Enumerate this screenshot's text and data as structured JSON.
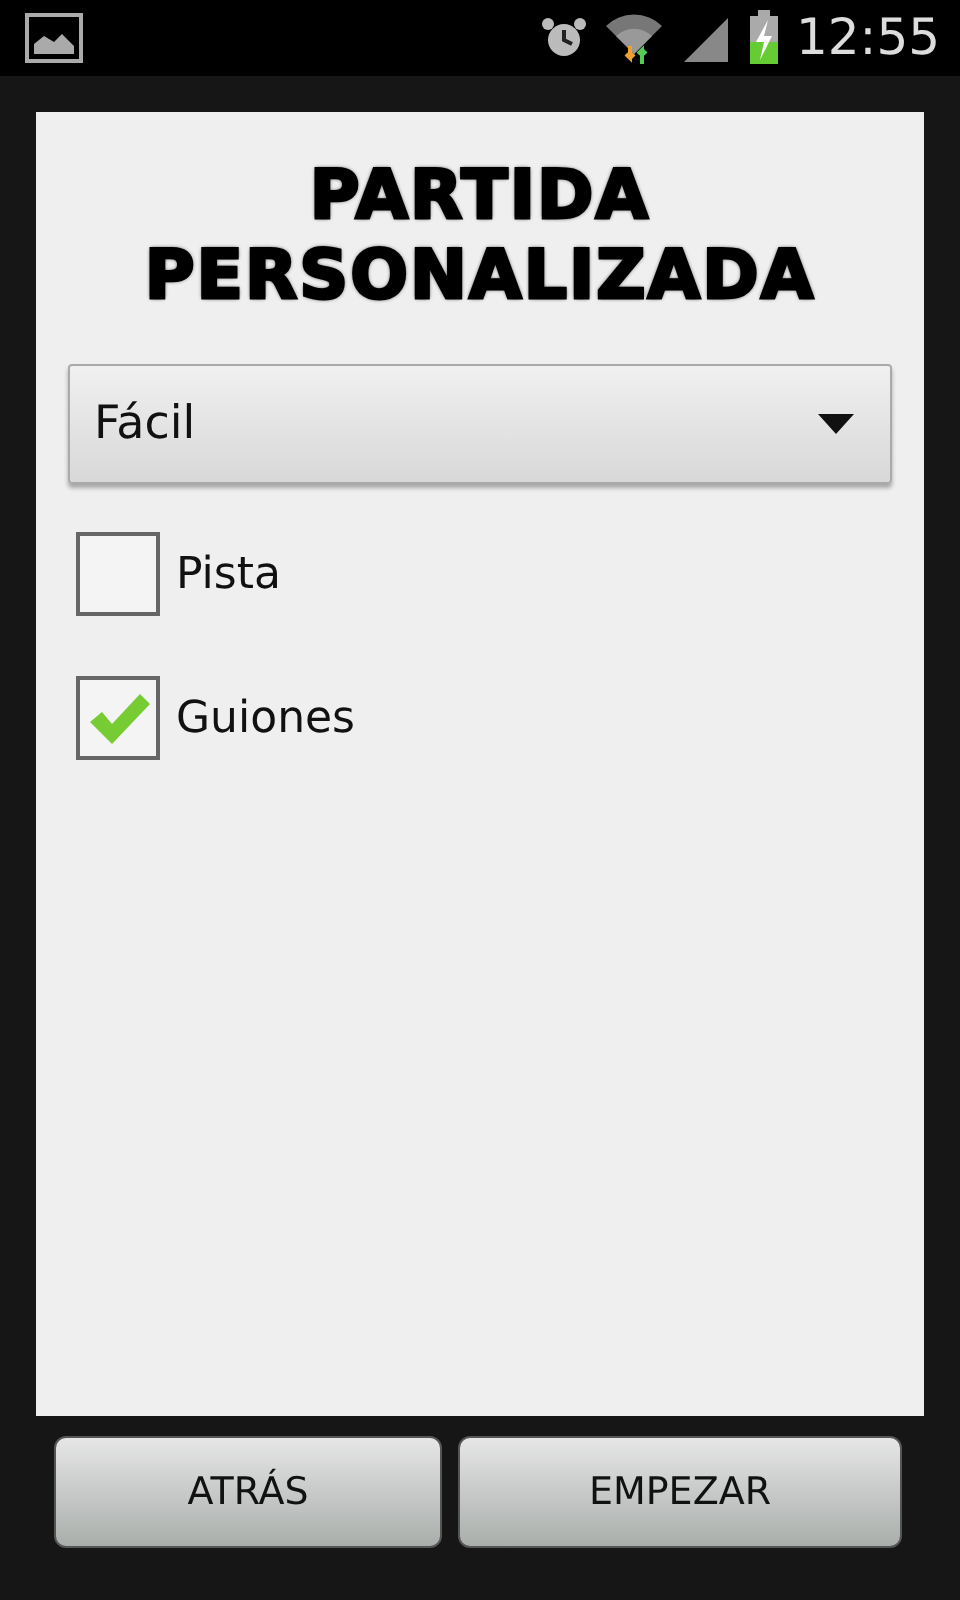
{
  "status_bar": {
    "time": "12:55"
  },
  "title": [
    "PARTIDA",
    "PERSONALIZADA"
  ],
  "difficulty": {
    "value": "Fácil"
  },
  "options": [
    {
      "label": "Pista",
      "checked": false
    },
    {
      "label": "Guiones",
      "checked": true
    }
  ],
  "buttons": [
    "ATRÁS",
    "EMPEZAR"
  ]
}
